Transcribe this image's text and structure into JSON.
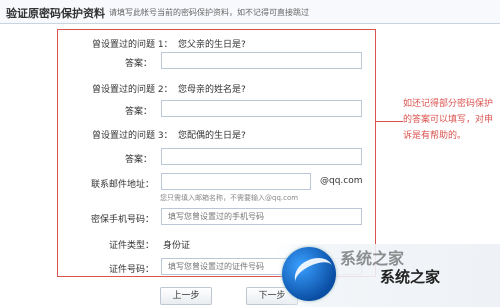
{
  "header": {
    "title": "验证原密码保护资料",
    "description": "请填写此帐号当前的密码保护资料，如不记得可直接跳过"
  },
  "form": {
    "questions": [
      {
        "label": "曾设置过的问题 1：",
        "question": "您父亲的生日是?",
        "answer_label": "答案：",
        "answer_value": ""
      },
      {
        "label": "曾设置过的问题 2：",
        "question": "您母亲的姓名是?",
        "answer_label": "答案：",
        "answer_value": ""
      },
      {
        "label": "曾设置过的问题 3：",
        "question": "您配偶的生日是?",
        "answer_label": "答案：",
        "answer_value": ""
      }
    ],
    "email": {
      "label": "联系邮件地址：",
      "value": "",
      "suffix": "@qq.com",
      "hint": "您只需填入邮箱名称，不需要输入@qq.com"
    },
    "phone": {
      "label": "密保手机号码：",
      "placeholder": "填写您曾设置过的手机号码"
    },
    "id_type": {
      "label": "证件类型：",
      "value": "身份证"
    },
    "id_number": {
      "label": "证件号码：",
      "placeholder": "填写您曾设置过的证件号码"
    }
  },
  "callout": {
    "text": "如还记得部分密码保护的答案可以填写，对申诉是有帮助的。",
    "color": "#d9534f"
  },
  "buttons": {
    "prev": "上一步",
    "next": "下一步"
  },
  "watermark": {
    "text": "系统之家",
    "sup": "系统之家"
  }
}
